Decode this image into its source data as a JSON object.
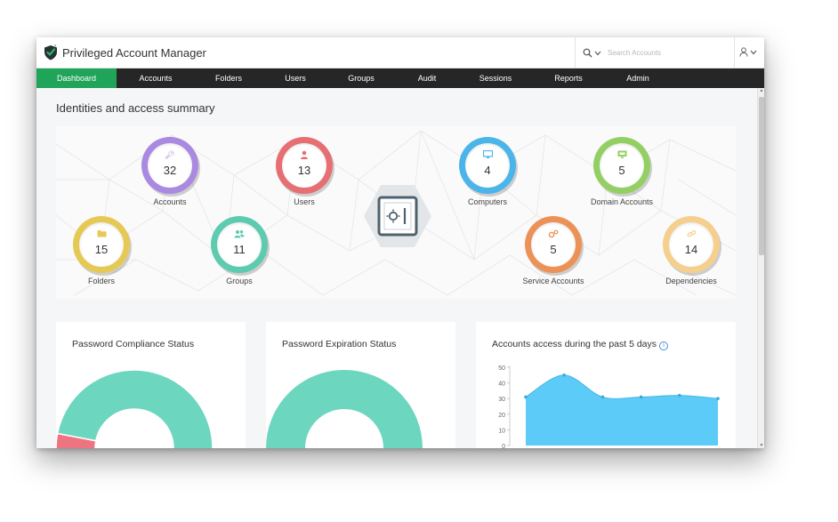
{
  "app": {
    "title": "Privileged Account Manager"
  },
  "search": {
    "placeholder": "Search Accounts"
  },
  "nav": {
    "tabs": [
      {
        "label": "Dashboard",
        "active": true
      },
      {
        "label": "Accounts"
      },
      {
        "label": "Folders"
      },
      {
        "label": "Users"
      },
      {
        "label": "Groups"
      },
      {
        "label": "Audit"
      },
      {
        "label": "Sessions"
      },
      {
        "label": "Reports"
      },
      {
        "label": "Admin"
      }
    ]
  },
  "summary": {
    "title": "Identities and access summary",
    "stats": [
      {
        "label": "Accounts",
        "value": "32",
        "color": "#a98ae0",
        "icon": "key-icon"
      },
      {
        "label": "Users",
        "value": "13",
        "color": "#e66f73",
        "icon": "user-icon"
      },
      {
        "label": "Computers",
        "value": "4",
        "color": "#4bb5ea",
        "icon": "monitor-icon"
      },
      {
        "label": "Domain Accounts",
        "value": "5",
        "color": "#93cf63",
        "icon": "domain-monitor-icon"
      },
      {
        "label": "Folders",
        "value": "15",
        "color": "#e6c955",
        "icon": "folder-icon"
      },
      {
        "label": "Groups",
        "value": "11",
        "color": "#5ccbb0",
        "icon": "group-icon"
      },
      {
        "label": "Service Accounts",
        "value": "5",
        "color": "#ec9258",
        "icon": "gears-icon"
      },
      {
        "label": "Dependencies",
        "value": "14",
        "color": "#f5cf8e",
        "icon": "link-icon"
      }
    ]
  },
  "cards": {
    "compliance": {
      "title": "Password Compliance Status"
    },
    "expiration": {
      "title": "Password Expiration Status"
    },
    "access": {
      "title": "Accounts access during the past 5 days"
    }
  },
  "chart_data": [
    {
      "type": "pie",
      "title": "Password Compliance Status",
      "values": [
        78,
        22
      ],
      "colors": [
        "#6dd6bf",
        "#ef7482"
      ]
    },
    {
      "type": "pie",
      "title": "Password Expiration Status",
      "values": [
        100
      ],
      "colors": [
        "#6dd6bf"
      ]
    },
    {
      "type": "area",
      "title": "Accounts access during the past 5 days",
      "x": [
        0,
        1,
        2,
        3,
        4,
        5
      ],
      "values": [
        31,
        45,
        31,
        31,
        32,
        30
      ],
      "ylim": [
        0,
        50
      ],
      "yticks": [
        "0",
        "10",
        "20",
        "30",
        "40",
        "50"
      ],
      "color": "#5ccbf7",
      "grid": false
    }
  ],
  "colors": {
    "accent": "#20a45a",
    "nav_bg": "#262626"
  }
}
